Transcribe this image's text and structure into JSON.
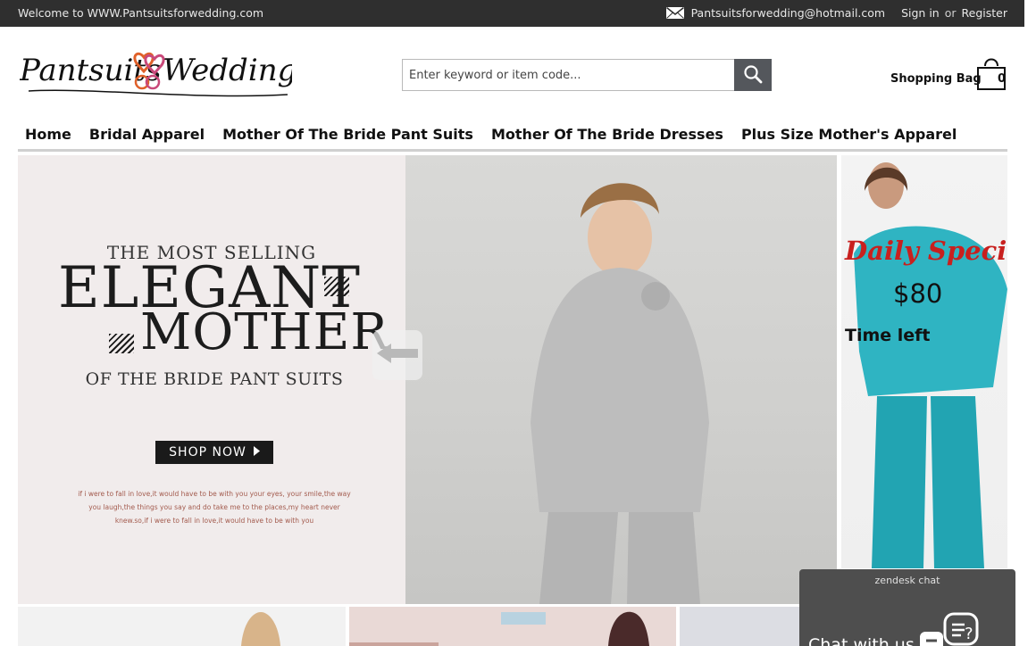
{
  "topbar": {
    "welcome": "Welcome to WWW.Pantsuitsforwedding.com",
    "email": "Pantsuitsforwedding@hotmail.com",
    "sign_in": "Sign in",
    "or": "or",
    "register": "Register",
    "mail_icon": "envelope-icon",
    "bg_color": "#2f2f2f"
  },
  "logo": {
    "text_left": "Pantsuits",
    "text_right": "Wedding"
  },
  "search": {
    "placeholder": "Enter keyword or item code...",
    "value": "",
    "button_icon": "search-icon"
  },
  "bag": {
    "label": "Shopping Bag",
    "count": "0",
    "icon": "shopping-bag-icon"
  },
  "nav": {
    "items": [
      {
        "label": "Home"
      },
      {
        "label": "Bridal Apparel"
      },
      {
        "label": "Mother Of The Bride Pant Suits"
      },
      {
        "label": "Mother Of The Bride Dresses"
      },
      {
        "label": "Plus Size Mother's Apparel"
      }
    ]
  },
  "hero": {
    "kicker": "THE MOST SELLING",
    "line1": "ELEGANT",
    "line2": "MOTHER",
    "line3": "OF THE BRIDE PANT SUITS",
    "shop_now": "SHOP NOW",
    "tagline": "if i were to fall in love,it would have to be with you your eyes, your smile,the way you laugh,the things you say and do take me to the places,my heart never knew.so,if i were to fall in love,it would have to be with you",
    "prev_icon": "arrow-left-icon"
  },
  "special": {
    "title": "Daily Special",
    "price": "$80",
    "time_left": "Time left"
  },
  "chat": {
    "brand": "zendesk chat",
    "cta": "Chat with us",
    "icon": "chat-bubble-icon"
  }
}
